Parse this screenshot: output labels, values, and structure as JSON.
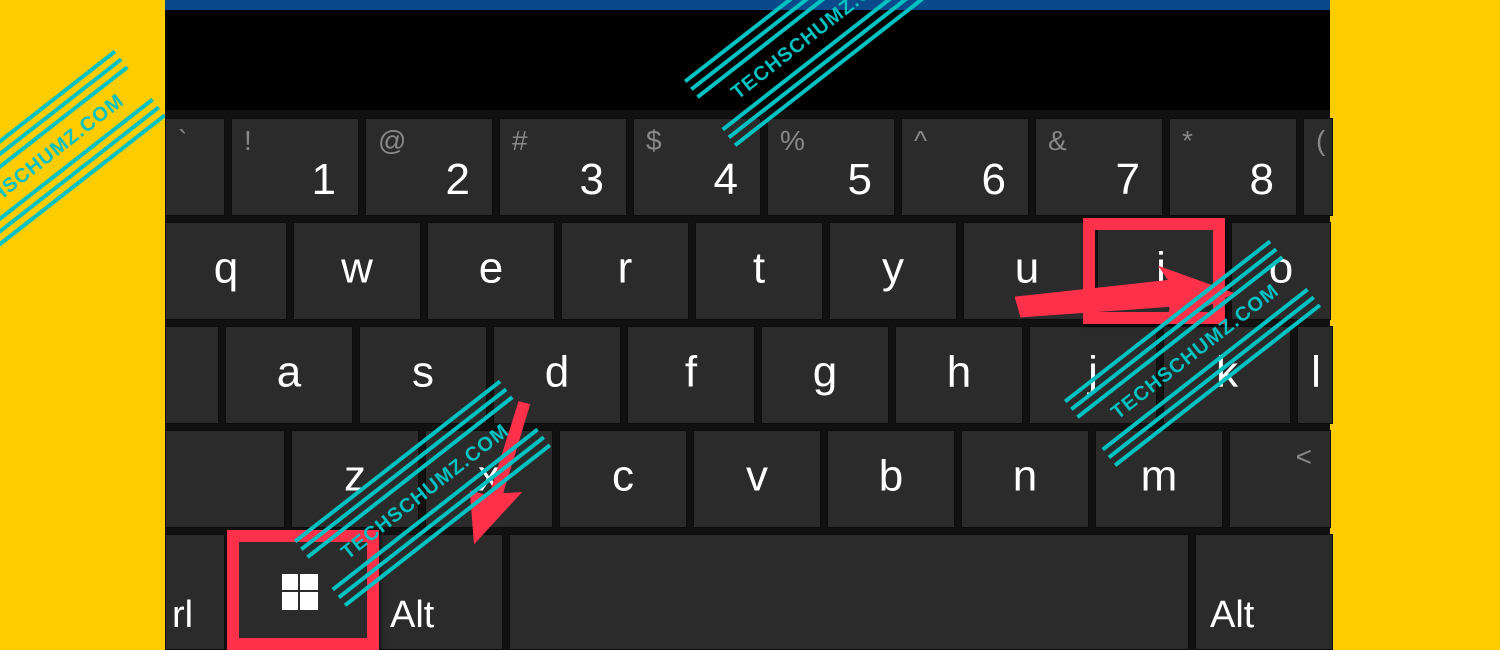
{
  "watermark_text": "TECHSCHUMZ.COM",
  "keyboard": {
    "row_numbers": [
      {
        "shift": "`",
        "main": ""
      },
      {
        "shift": "!",
        "main": "1"
      },
      {
        "shift": "@",
        "main": "2"
      },
      {
        "shift": "#",
        "main": "3"
      },
      {
        "shift": "$",
        "main": "4"
      },
      {
        "shift": "%",
        "main": "5"
      },
      {
        "shift": "^",
        "main": "6"
      },
      {
        "shift": "&",
        "main": "7"
      },
      {
        "shift": "*",
        "main": "8"
      },
      {
        "shift": "(",
        "main": ""
      }
    ],
    "row_qwerty": [
      "q",
      "w",
      "e",
      "r",
      "t",
      "y",
      "u",
      "i",
      "o"
    ],
    "row_asdf": [
      "a",
      "s",
      "d",
      "f",
      "g",
      "h",
      "j",
      "k",
      "l"
    ],
    "row_zxcv": [
      "z",
      "x",
      "c",
      "v",
      "b",
      "n",
      "m"
    ],
    "row_zxcv_shift_last": "<",
    "mod_ctrl": "rl",
    "mod_alt_left": "Alt",
    "mod_alt_right": "Alt"
  },
  "highlights": {
    "key_i": "i",
    "key_win": "Windows key"
  },
  "annotations": {
    "arrow_to_i": "arrow pointing right to i key",
    "arrow_to_win": "arrow pointing down to Windows key"
  }
}
